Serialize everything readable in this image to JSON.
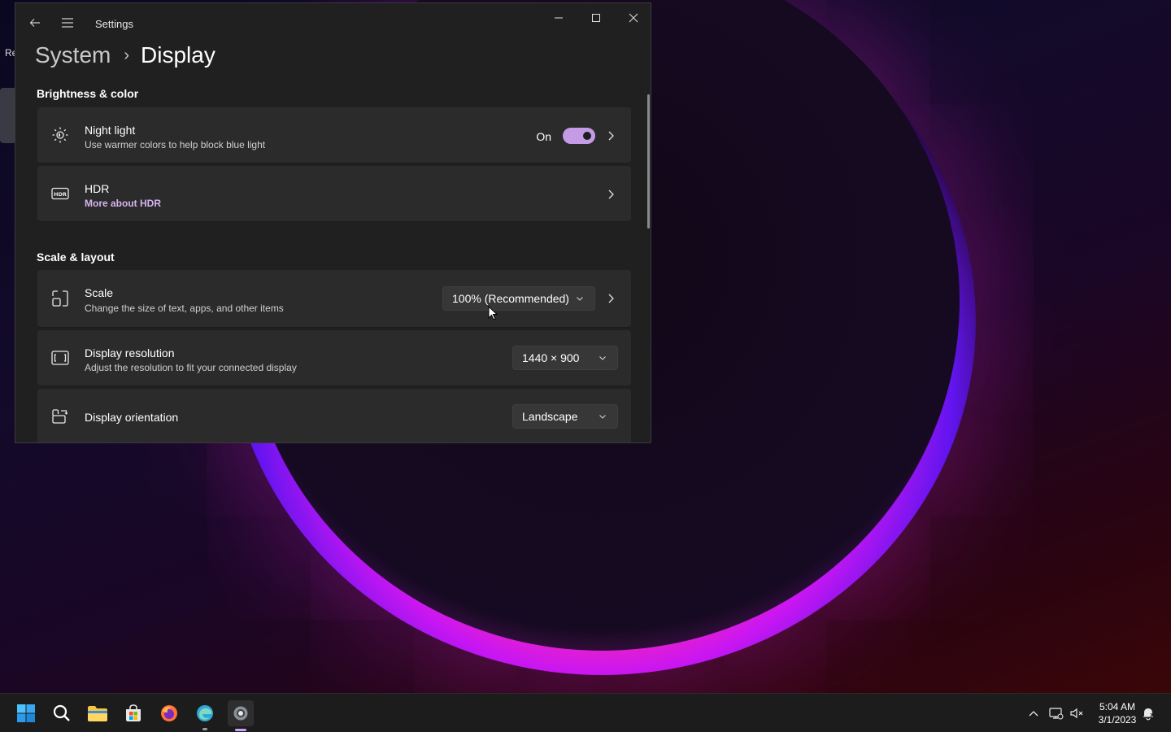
{
  "desktop": {
    "peek_text": "Re"
  },
  "window": {
    "title": "Settings",
    "breadcrumb": {
      "parent": "System",
      "separator": "›",
      "current": "Display"
    },
    "controls": {
      "minimize": "—",
      "maximize": "☐",
      "close": "✕"
    }
  },
  "sections": {
    "brightness_color": "Brightness & color",
    "scale_layout": "Scale & layout"
  },
  "night_light": {
    "title": "Night light",
    "subtitle": "Use warmer colors to help block blue light",
    "state_label": "On",
    "enabled": true,
    "icon": "brightness-icon"
  },
  "hdr": {
    "title": "HDR",
    "link": "More about HDR",
    "icon": "hdr-icon"
  },
  "scale": {
    "title": "Scale",
    "subtitle": "Change the size of text, apps, and other items",
    "value": "100% (Recommended)",
    "icon": "scale-icon"
  },
  "resolution": {
    "title": "Display resolution",
    "subtitle": "Adjust the resolution to fit your connected display",
    "value": "1440 × 900",
    "icon": "resolution-icon"
  },
  "orientation": {
    "title": "Display orientation",
    "value": "Landscape",
    "icon": "orientation-icon"
  },
  "taskbar": {
    "apps": [
      "start",
      "search",
      "file-explorer",
      "microsoft-store",
      "firefox",
      "edge-beta",
      "settings"
    ],
    "clock": {
      "time": "5:04 AM",
      "date": "3/1/2023"
    }
  },
  "colors": {
    "accent": "#c59be6",
    "window_bg": "#202020",
    "card_bg": "#2b2b2b"
  }
}
